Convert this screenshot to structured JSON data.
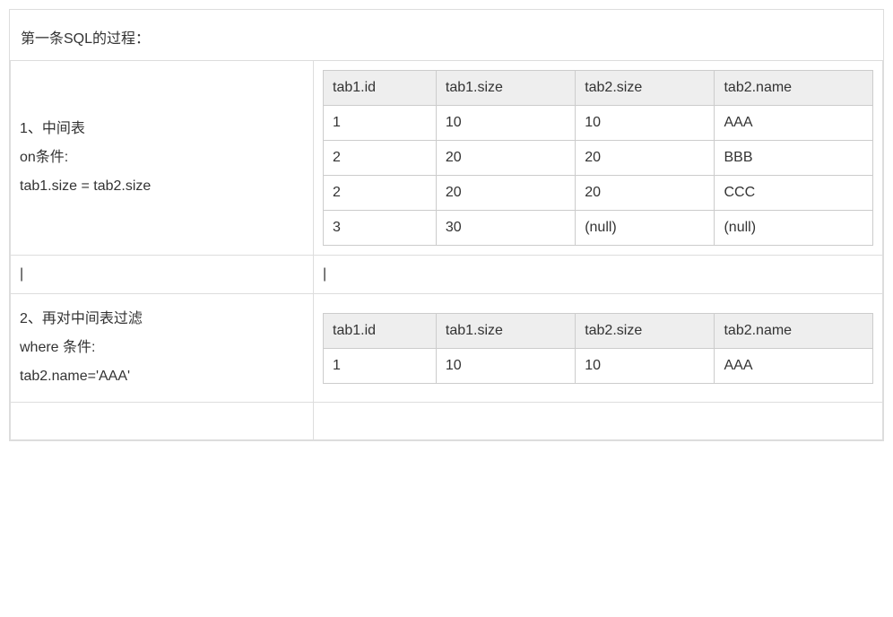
{
  "title": "第一条SQL的过程：",
  "step1": {
    "line1": "1、中间表",
    "line2": "on条件:",
    "line3": "tab1.size = tab2.size"
  },
  "step2": {
    "line1": "2、再对中间表过滤",
    "line2": "where 条件:",
    "line3": "tab2.name='AAA'"
  },
  "headers": {
    "c1": "tab1.id",
    "c2": "tab1.size",
    "c3": "tab2.size",
    "c4": "tab2.name"
  },
  "table1": [
    {
      "c1": "1",
      "c2": "10",
      "c3": "10",
      "c4": "AAA"
    },
    {
      "c1": "2",
      "c2": "20",
      "c3": "20",
      "c4": "BBB"
    },
    {
      "c1": "2",
      "c2": "20",
      "c3": "20",
      "c4": "CCC"
    },
    {
      "c1": "3",
      "c2": "30",
      "c3": "(null)",
      "c4": "(null)"
    }
  ],
  "table2": [
    {
      "c1": "1",
      "c2": "10",
      "c3": "10",
      "c4": "AAA"
    }
  ],
  "pipe": "|"
}
